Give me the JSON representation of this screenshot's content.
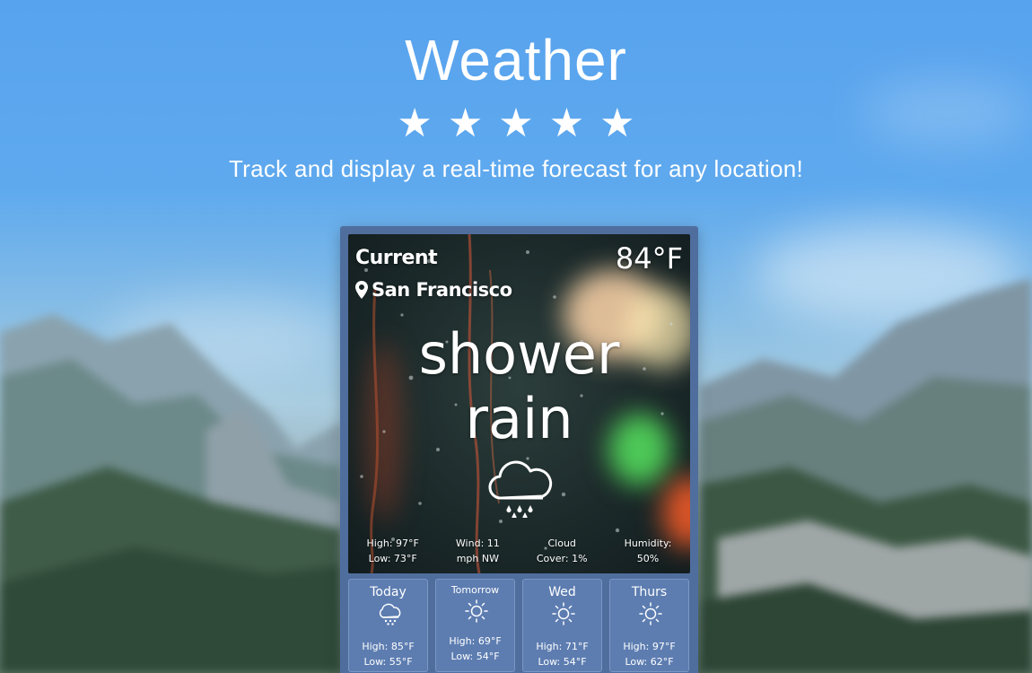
{
  "header": {
    "title": "Weather",
    "rating": "★★★★★",
    "tagline": "Track and display a real-time forecast for any location!"
  },
  "current": {
    "label": "Current",
    "temperature": "84°F",
    "location": "San Francisco",
    "condition_line1": "shower",
    "condition_line2": "rain",
    "icon": "cloud-rain-icon",
    "stats": [
      {
        "line1": "High: 97°F",
        "line2": "Low: 73°F"
      },
      {
        "line1": "Wind: 11",
        "line2": "mph NW"
      },
      {
        "line1": "Cloud",
        "line2": "Cover: 1%"
      },
      {
        "line1": "Humidity:",
        "line2": "50%"
      }
    ]
  },
  "forecast": [
    {
      "day": "Today",
      "icon": "cloud-rain-icon",
      "high": "High: 85°F",
      "low": "Low: 55°F"
    },
    {
      "day": "Tomorrow",
      "icon": "sun-icon",
      "high": "High: 69°F",
      "low": "Low: 54°F"
    },
    {
      "day": "Wed",
      "icon": "sun-icon",
      "high": "High: 71°F",
      "low": "Low: 54°F"
    },
    {
      "day": "Thurs",
      "icon": "sun-icon",
      "high": "High: 97°F",
      "low": "Low: 62°F"
    }
  ],
  "colors": {
    "sky": "#58a3ee",
    "widget_frame": "#4f6e9e",
    "forecast_card": "#5d7db1",
    "text": "#ffffff"
  }
}
